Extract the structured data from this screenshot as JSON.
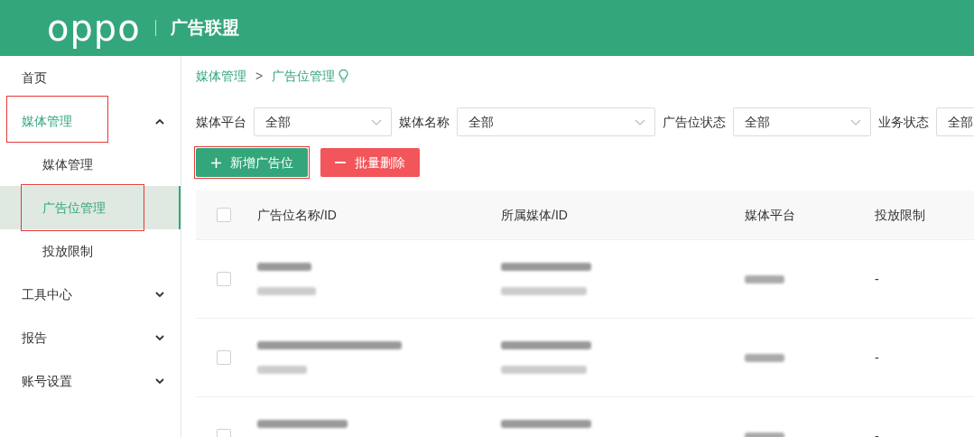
{
  "header": {
    "logo": "oppo",
    "title": "广告联盟"
  },
  "sidebar": {
    "items": [
      {
        "label": "首页",
        "selected": false,
        "highlighted": false
      },
      {
        "label": "媒体管理",
        "selected": false,
        "highlighted": true,
        "expanded": true,
        "children": [
          {
            "label": "媒体管理",
            "selected": false,
            "highlighted": false
          },
          {
            "label": "广告位管理",
            "selected": true,
            "highlighted": true
          },
          {
            "label": "投放限制",
            "selected": false,
            "highlighted": false
          }
        ]
      },
      {
        "label": "工具中心",
        "selected": false,
        "highlighted": false,
        "expanded": false
      },
      {
        "label": "报告",
        "selected": false,
        "highlighted": false,
        "expanded": false
      },
      {
        "label": "账号设置",
        "selected": false,
        "highlighted": false,
        "expanded": false
      }
    ]
  },
  "breadcrumb": [
    "媒体管理",
    "广告位管理"
  ],
  "breadcrumb_separator": ">",
  "filters": [
    {
      "label": "媒体平台",
      "value": "全部"
    },
    {
      "label": "媒体名称",
      "value": "全部"
    },
    {
      "label": "广告位状态",
      "value": "全部"
    },
    {
      "label": "业务状态",
      "value": "全部"
    }
  ],
  "buttons": [
    {
      "kind": "add",
      "label": "新增广告位",
      "highlighted": true
    },
    {
      "kind": "delete",
      "label": "批量删除",
      "highlighted": false
    }
  ],
  "table": {
    "header_checked": false,
    "columns": [
      "广告位名称/ID",
      "所属媒体/ID",
      "媒体平台",
      "投放限制"
    ],
    "rows": [
      {
        "checked": false,
        "restriction": "-"
      },
      {
        "checked": false,
        "restriction": "-"
      },
      {
        "checked": false,
        "restriction": "-"
      }
    ]
  }
}
